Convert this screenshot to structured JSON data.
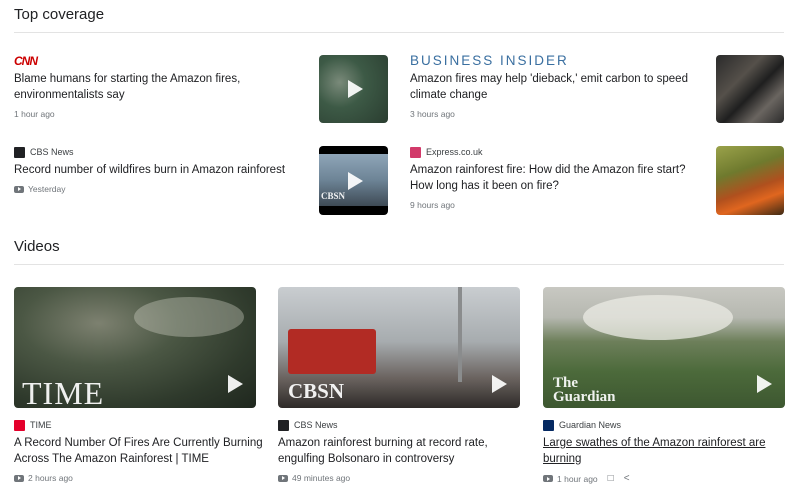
{
  "sections": {
    "top_coverage": "Top coverage",
    "videos": "Videos"
  },
  "top_stories": [
    {
      "source": "CNN",
      "headline": "Blame humans for starting the Amazon fires, environmentalists say",
      "time": "1 hour ago"
    },
    {
      "source": "BUSINESS INSIDER",
      "headline": "Amazon fires may help 'dieback,' emit carbon to speed climate change",
      "time": "3 hours ago"
    },
    {
      "source": "CBS News",
      "headline": "Record number of wildfires burn in Amazon rainforest",
      "time": "Yesterday",
      "thumb_label": "CBSN"
    },
    {
      "source": "Express.co.uk",
      "headline": "Amazon rainforest fire: How did the Amazon fire start? How long has it been on fire?",
      "time": "9 hours ago"
    }
  ],
  "videos": [
    {
      "source": "TIME",
      "headline": "A Record Number Of Fires Are Currently Burning Across The Amazon Rainforest | TIME",
      "time": "2 hours ago",
      "thumb_label": "TIME"
    },
    {
      "source": "CBS News",
      "headline": "Amazon rainforest burning at record rate, engulfing Bolsonaro in controversy",
      "time": "49 minutes ago",
      "thumb_label": "CBSN"
    },
    {
      "source": "Guardian News",
      "headline": "Large swathes of the Amazon rainforest are burning",
      "time": "1 hour ago",
      "thumb_label": [
        "The",
        "Guardian"
      ]
    }
  ],
  "colors": {
    "cnn_red": "#cc0000",
    "bi_blue": "#3a6fa0",
    "time_red": "#e4002b",
    "express_pink": "#d23a6a",
    "guardian_navy": "#052962"
  },
  "icons": {
    "video": "video-icon",
    "save": "bookmark-icon",
    "share": "share-icon"
  }
}
